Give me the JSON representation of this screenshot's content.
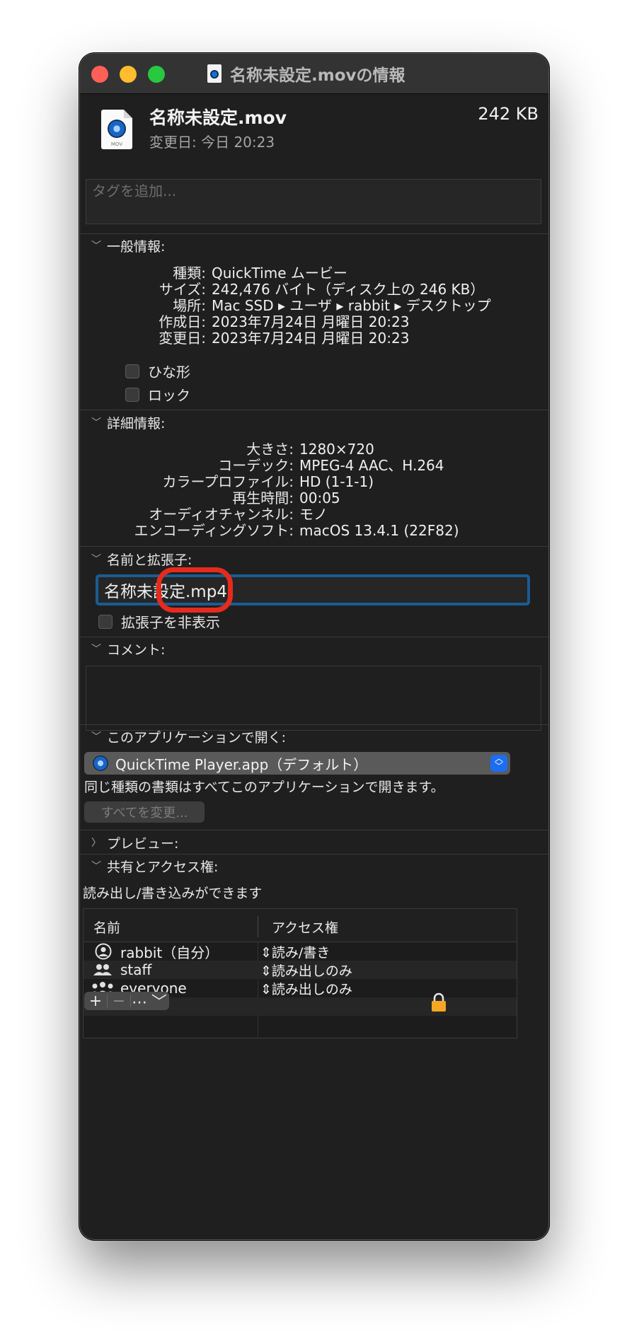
{
  "window": {
    "title": "名称未設定.movの情報"
  },
  "header": {
    "filename": "名称未設定.mov",
    "size": "242 KB",
    "modified": "変更日: 今日 20:23",
    "icon_ext": "MOV",
    "tags_placeholder": "タグを追加..."
  },
  "general": {
    "heading": "一般情報:",
    "rows": [
      {
        "key": "種類:",
        "value": "QuickTime ムービー"
      },
      {
        "key": "サイズ:",
        "value": "242,476 バイト（ディスク上の 246 KB）"
      },
      {
        "key": "場所:",
        "value": "Mac SSD ▸ ユーザ ▸ rabbit ▸ デスクトップ"
      },
      {
        "key": "作成日:",
        "value": "2023年7月24日 月曜日 20:23"
      },
      {
        "key": "変更日:",
        "value": "2023年7月24日 月曜日 20:23"
      }
    ],
    "stationery_label": "ひな形",
    "locked_label": "ロック"
  },
  "details": {
    "heading": "詳細情報:",
    "rows": [
      {
        "key": "大きさ:",
        "value": "1280×720"
      },
      {
        "key": "コーデック:",
        "value": "MPEG-4 AAC、H.264"
      },
      {
        "key": "カラープロファイル:",
        "value": "HD (1-1-1)"
      },
      {
        "key": "再生時間:",
        "value": "00:05"
      },
      {
        "key": "オーディオチャンネル:",
        "value": "モノ"
      },
      {
        "key": "エンコーディングソフト:",
        "value": "macOS 13.4.1 (22F82)"
      }
    ]
  },
  "name_ext": {
    "heading": "名前と拡張子:",
    "value": "名称未設定.mp4",
    "hide_ext_label": "拡張子を非表示"
  },
  "comments": {
    "heading": "コメント:"
  },
  "open_with": {
    "heading": "このアプリケーションで開く:",
    "app": "QuickTime Player.app（デフォルト）",
    "description": "同じ種類の書類はすべてこのアプリケーションで開きます。",
    "change_all": "すべてを変更..."
  },
  "preview": {
    "heading": "プレビュー:"
  },
  "sharing": {
    "heading": "共有とアクセス権:",
    "status": "読み出し/書き込みができます",
    "col_name": "名前",
    "col_access": "アクセス権",
    "rows": [
      {
        "name": "rabbit（自分）",
        "access": "読み/書き",
        "icon": "user-icon"
      },
      {
        "name": "staff",
        "access": "読み出しのみ",
        "icon": "group-icon"
      },
      {
        "name": "everyone",
        "access": "読み出しのみ",
        "icon": "everyone-icon"
      }
    ],
    "add_symbol": "+",
    "remove_symbol": "−",
    "action_symbol": "⋯"
  },
  "colors": {
    "window_bg": "#1f1f1f",
    "focus_ring": "#1b5c93",
    "annotation_red": "#e52b1d",
    "popup_blue": "#1c6ef0",
    "lock_orange": "#f5a623"
  }
}
